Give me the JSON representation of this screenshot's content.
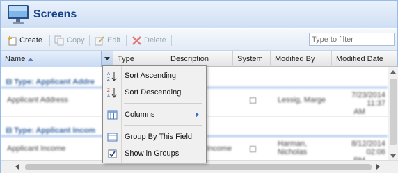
{
  "header": {
    "title": "Screens"
  },
  "toolbar": {
    "create_label": "Create",
    "copy_label": "Copy",
    "edit_label": "Edit",
    "delete_label": "Delete",
    "filter_placeholder": "Type to filter"
  },
  "columns": [
    "Name",
    "Type",
    "Description",
    "System",
    "Modified By",
    "Modified Date"
  ],
  "groups": [
    {
      "label": "Type: Applicant Addre",
      "rows": [
        {
          "name": "Applicant Address",
          "description": "",
          "modified_by": "Lessig, Marge",
          "modified_date_line1": "7/23/2014 11:37",
          "modified_date_line2": "AM"
        }
      ]
    },
    {
      "label": "Type: Applicant Incom",
      "rows": [
        {
          "name": "Applicant Income",
          "description": "Income",
          "modified_by_line1": "Harman,",
          "modified_by_line2": "Nicholas",
          "modified_date_line1": "8/12/2014 02:06",
          "modified_date_line2": "PM"
        }
      ]
    }
  ],
  "column_menu": {
    "sort_ascending": "Sort Ascending",
    "sort_descending": "Sort Descending",
    "columns": "Columns",
    "group_by_field": "Group By This Field",
    "show_in_groups": "Show in Groups",
    "show_in_groups_checked": true
  },
  "colors": {
    "accent": "#15428b",
    "border": "#99bbe8",
    "delete_icon": "#d9534f"
  }
}
